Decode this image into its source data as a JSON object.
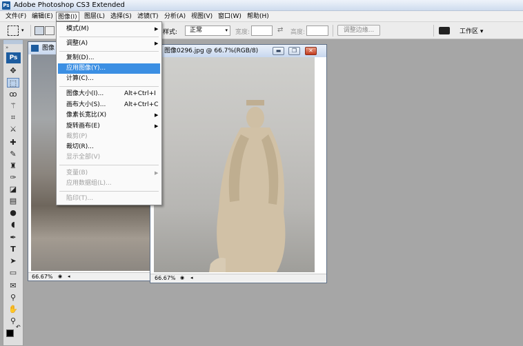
{
  "app": {
    "title": "Adobe Photoshop CS3 Extended",
    "logo_text": "Ps"
  },
  "menubar": {
    "items": [
      {
        "label": "文件(F)"
      },
      {
        "label": "编辑(E)"
      },
      {
        "label": "图像(I)"
      },
      {
        "label": "图层(L)"
      },
      {
        "label": "选择(S)"
      },
      {
        "label": "滤镜(T)"
      },
      {
        "label": "分析(A)"
      },
      {
        "label": "视图(V)"
      },
      {
        "label": "窗口(W)"
      },
      {
        "label": "帮助(H)"
      }
    ],
    "active_item": "图像(I)"
  },
  "options_bar": {
    "style_label": "样式:",
    "style_value": "正常",
    "width_label": "宽度:",
    "height_label": "高度:",
    "refine_button": "调整边缘...",
    "workspace_button": "工作区"
  },
  "dropdown": {
    "items": [
      {
        "label": "模式(M)",
        "shortcut": "",
        "submenu": true,
        "enabled": true
      },
      {
        "label": "调整(A)",
        "shortcut": "",
        "submenu": true,
        "enabled": true
      },
      {
        "label": "复制(D)...",
        "shortcut": "",
        "submenu": false,
        "enabled": true
      },
      {
        "label": "应用图像(Y)...",
        "shortcut": "",
        "submenu": false,
        "enabled": true,
        "highlighted": true
      },
      {
        "label": "计算(C)...",
        "shortcut": "",
        "submenu": false,
        "enabled": true
      },
      {
        "label": "图像大小(I)...",
        "shortcut": "Alt+Ctrl+I",
        "submenu": false,
        "enabled": true
      },
      {
        "label": "画布大小(S)...",
        "shortcut": "Alt+Ctrl+C",
        "submenu": false,
        "enabled": true
      },
      {
        "label": "像素长宽比(X)",
        "shortcut": "",
        "submenu": true,
        "enabled": true
      },
      {
        "label": "旋转画布(E)",
        "shortcut": "",
        "submenu": true,
        "enabled": true
      },
      {
        "label": "裁剪(P)",
        "shortcut": "",
        "submenu": false,
        "enabled": false
      },
      {
        "label": "裁切(R)...",
        "shortcut": "",
        "submenu": false,
        "enabled": true
      },
      {
        "label": "显示全部(V)",
        "shortcut": "",
        "submenu": false,
        "enabled": false
      },
      {
        "label": "变量(B)",
        "shortcut": "",
        "submenu": true,
        "enabled": false
      },
      {
        "label": "应用数据组(L)...",
        "shortcut": "",
        "submenu": false,
        "enabled": false
      },
      {
        "label": "陷印(T)...",
        "shortcut": "",
        "submenu": false,
        "enabled": false
      }
    ]
  },
  "doc_back": {
    "title": "图像",
    "zoom": "66.67%"
  },
  "doc_front": {
    "title": "图像0296.jpg @ 66.7%(RGB/8)",
    "zoom": "66.67%"
  },
  "toolbox": {
    "tools": [
      "move-tool",
      "marquee-tool",
      "lasso-tool",
      "magic-wand-tool",
      "crop-tool",
      "slice-tool",
      "healing-brush-tool",
      "brush-tool",
      "clone-stamp-tool",
      "history-brush-tool",
      "eraser-tool",
      "gradient-tool",
      "blur-tool",
      "dodge-tool",
      "pen-tool",
      "type-tool",
      "path-selection-tool",
      "shape-tool",
      "notes-tool",
      "eyedropper-tool",
      "hand-tool",
      "zoom-tool"
    ],
    "selected_tool": "marquee-tool",
    "foreground_color": "#000000",
    "background_color": "#ffffff"
  },
  "colors": {
    "highlight": "#3b8fe3",
    "workspace_bg": "#a6a6a6",
    "title_bar": "#cfdcee"
  }
}
